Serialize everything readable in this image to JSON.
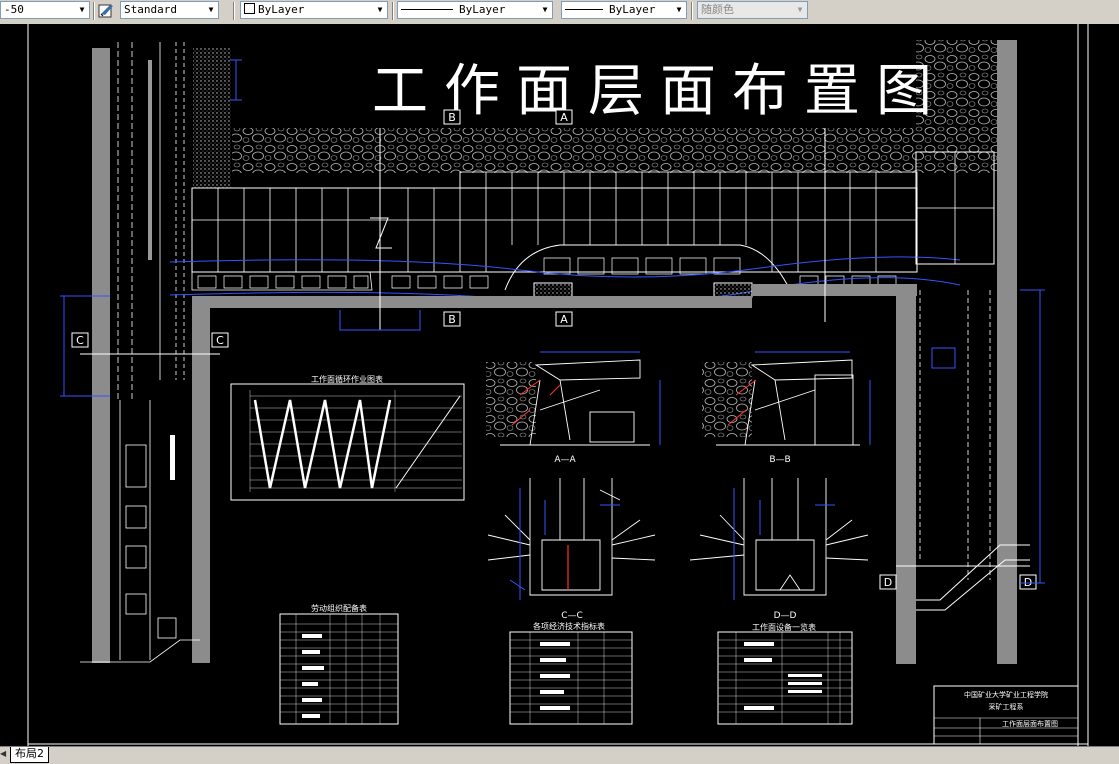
{
  "toolbar": {
    "layer_value": "-50",
    "text_style_icon": "text-style-icon",
    "text_style": "Standard",
    "color": "ByLayer",
    "linetype": "ByLayer",
    "lineweight": "ByLayer",
    "plot_style": "随颜色"
  },
  "drawing": {
    "title": "工作面层面布置图",
    "section_a_top": "A",
    "section_b_top": "B",
    "section_a_bottom": "A",
    "section_b_bottom": "B",
    "section_c_left": "C",
    "section_c_right": "C",
    "section_d_left": "D",
    "section_d_right": "D",
    "cycle_chart_title": "工作面循环作业图表",
    "view_aa": "A—A",
    "view_bb": "B—B",
    "view_cc": "C—C",
    "view_dd": "D—D",
    "labor_table_title": "劳动组织配备表",
    "tech_table_title": "各项经济技术指标表",
    "equip_table_title": "工作面设备一览表",
    "titleblock_school": "中国矿业大学矿业工程学院",
    "titleblock_dept": "采矿工程系",
    "titleblock_drawing": "工作面层面布置图"
  },
  "tabs": {
    "layout2": "布局2"
  },
  "icons": {
    "dropdown": "chevron-down-icon",
    "tab_scroll": "tab-scroll-icon"
  }
}
